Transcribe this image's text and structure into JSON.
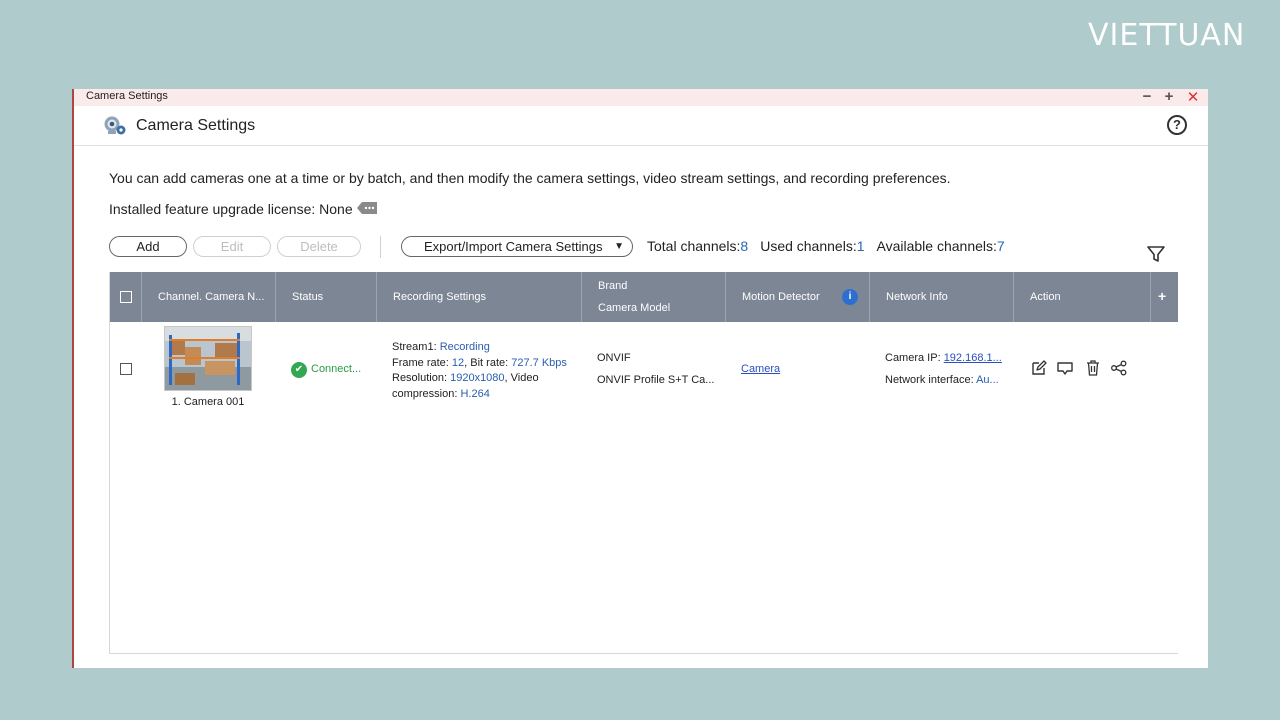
{
  "brand_logo": "VIETTUAN",
  "window": {
    "titlebar_title": "Camera Settings",
    "controls": {
      "minimize": "−",
      "maximize": "+",
      "close": "✕"
    }
  },
  "header": {
    "title": "Camera Settings",
    "help": "?"
  },
  "description": "You can add cameras one at a time or by batch, and then modify the camera settings, video stream settings, and recording preferences.",
  "license": "Installed feature upgrade license: None",
  "toolbar": {
    "add": "Add",
    "edit": "Edit",
    "delete": "Delete",
    "export": "Export/Import Camera Settings",
    "caret": "▼"
  },
  "channels": {
    "total_label": "Total channels:",
    "total": "8",
    "used_label": "Used channels:",
    "used": "1",
    "available_label": "Available channels:",
    "available": "7"
  },
  "table": {
    "columns": {
      "channel": "Channel. Camera N...",
      "status": "Status",
      "recording": "Recording Settings",
      "brand_line1": "Brand",
      "brand_line2": "Camera Model",
      "motion": "Motion Detector",
      "network": "Network Info",
      "action": "Action",
      "add_column": "+"
    },
    "info_badge": "i",
    "rows": [
      {
        "camera_name": "1. Camera 001",
        "status_icon": "✔",
        "status": "Connect...",
        "stream_label": "Stream1: ",
        "stream_value": "Recording",
        "framerate_label": "Frame rate: ",
        "framerate_value": "12",
        "bitrate_label": ", Bit rate: ",
        "bitrate_value": "727.7 Kbps",
        "resolution_label": "Resolution: ",
        "resolution_value": "1920x1080",
        "compression_label": ", Video compression: ",
        "compression_value": "H.264",
        "brand": "ONVIF",
        "model": "ONVIF Profile S+T Ca...",
        "motion_detector": "Camera",
        "ip_label": "Camera IP: ",
        "ip_value": "192.168.1...",
        "iface_label": "Network interface: ",
        "iface_value": "Au..."
      }
    ]
  },
  "colors": {
    "background": "#afcbcb",
    "table_header": "#7c8694",
    "link_blue": "#2a5db0",
    "status_green": "#32a852",
    "close_red": "#e03030"
  },
  "icons": {
    "camera": "camera-settings-icon",
    "license": "license-tag-icon",
    "filter": "filter-icon",
    "info": "info-icon",
    "edit": "edit-icon",
    "monitor": "monitor-icon",
    "delete": "trash-icon",
    "share": "share-icon"
  }
}
